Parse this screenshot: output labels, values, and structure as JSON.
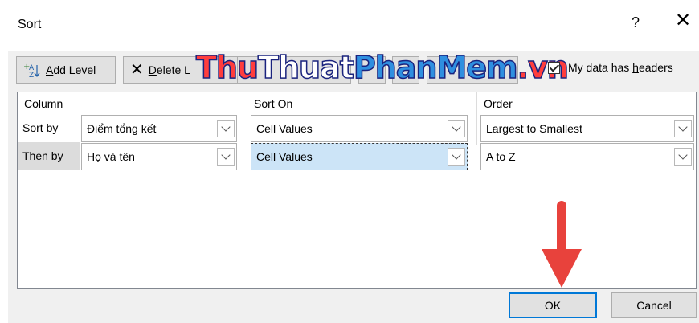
{
  "window": {
    "title": "Sort",
    "help": "?",
    "close": "✕"
  },
  "toolbar": {
    "add_level_prefix": "",
    "add_level_mnemonic": "A",
    "add_level_rest": "dd Level",
    "delete_level_prefix": "",
    "delete_level_mnemonic": "D",
    "delete_level_rest": "elete L"
  },
  "watermark": {
    "part1": "Thu",
    "part2": "Thuat",
    "part3": "PhanMem",
    "part4": ".vn"
  },
  "headers_option": {
    "prefix": "My data has ",
    "mnemonic": "h",
    "rest": "eaders",
    "checked": true
  },
  "grid": {
    "headers": {
      "column": "Column",
      "sort_on": "Sort On",
      "order": "Order"
    },
    "rows": [
      {
        "label": "Sort by",
        "column": "Điểm tổng kết",
        "sort_on": "Cell Values",
        "order": "Largest to Smallest"
      },
      {
        "label": "Then by",
        "column": "Họ và tên",
        "sort_on": "Cell Values",
        "order": "A to Z"
      }
    ]
  },
  "buttons": {
    "ok": "OK",
    "cancel": "Cancel"
  },
  "colors": {
    "accent": "#0078d7",
    "annotation_arrow": "#e8423c"
  }
}
